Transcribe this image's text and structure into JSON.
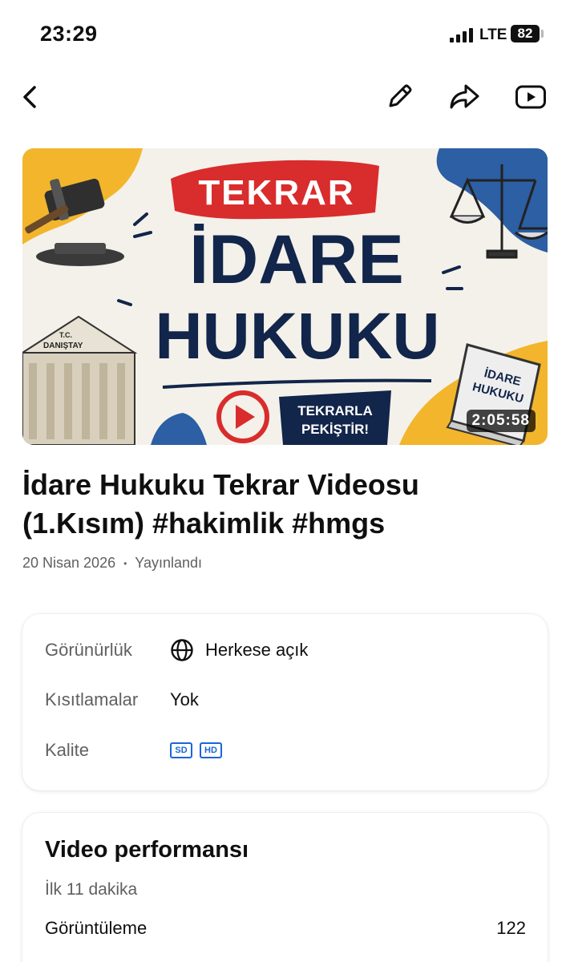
{
  "status_bar": {
    "time": "23:29",
    "network": "LTE",
    "battery": "82"
  },
  "video": {
    "thumbnail": {
      "tag": "TEKRAR",
      "headline_1": "İDARE",
      "headline_2": "HUKUKU",
      "building_text_1": "T.C.",
      "building_text_2": "DANIŞTAY",
      "book_text_1": "İDARE",
      "book_text_2": "HUKUKU",
      "badge_line_1": "TEKRARLA",
      "badge_line_2": "PEKİŞTİR!"
    },
    "duration": "2:05:58",
    "title": "İdare Hukuku Tekrar Videosu (1.Kısım) #hakimlik #hmgs",
    "date": "20 Nisan 2026",
    "separator": "•",
    "status": "Yayınlandı"
  },
  "details": {
    "visibility_label": "Görünürlük",
    "visibility_value": "Herkese açık",
    "restrictions_label": "Kısıtlamalar",
    "restrictions_value": "Yok",
    "quality_label": "Kalite",
    "quality_sd": "SD",
    "quality_hd": "HD"
  },
  "performance": {
    "title": "Video performansı",
    "subtitle": "İlk 11 dakika",
    "views_label": "Görüntüleme",
    "views_value": "122"
  },
  "colors": {
    "accent_blue": "#1a66d6",
    "thumb_red": "#d92c2c",
    "thumb_navy": "#12254a",
    "thumb_yellow": "#f2b52c",
    "thumb_blue": "#2c5fa3"
  },
  "icons": [
    "back-icon",
    "edit-icon",
    "share-icon",
    "youtube-icon",
    "globe-icon",
    "play-icon"
  ]
}
